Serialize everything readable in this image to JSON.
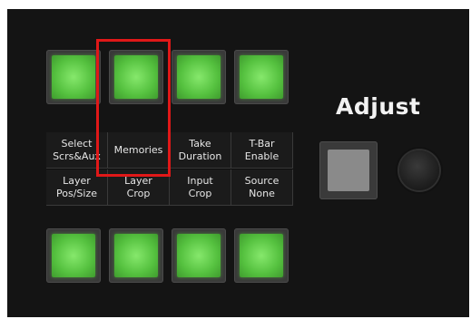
{
  "panel": {
    "title": "Adjust",
    "softkeys": [
      {
        "line1": "Select",
        "line2": "Scrs&Aux"
      },
      {
        "line1": "Memories",
        "line2": ""
      },
      {
        "line1": "Take",
        "line2": "Duration"
      },
      {
        "line1": "T-Bar",
        "line2": "Enable"
      },
      {
        "line1": "Layer",
        "line2": "Pos/Size"
      },
      {
        "line1": "Layer",
        "line2": "Crop"
      },
      {
        "line1": "Input",
        "line2": "Crop"
      },
      {
        "line1": "Source",
        "line2": "None"
      }
    ]
  },
  "colors": {
    "button_green": "#55c13f",
    "adjust_button": "#8a8a8a",
    "highlight": "#e01818",
    "panel_background": "#141414"
  }
}
